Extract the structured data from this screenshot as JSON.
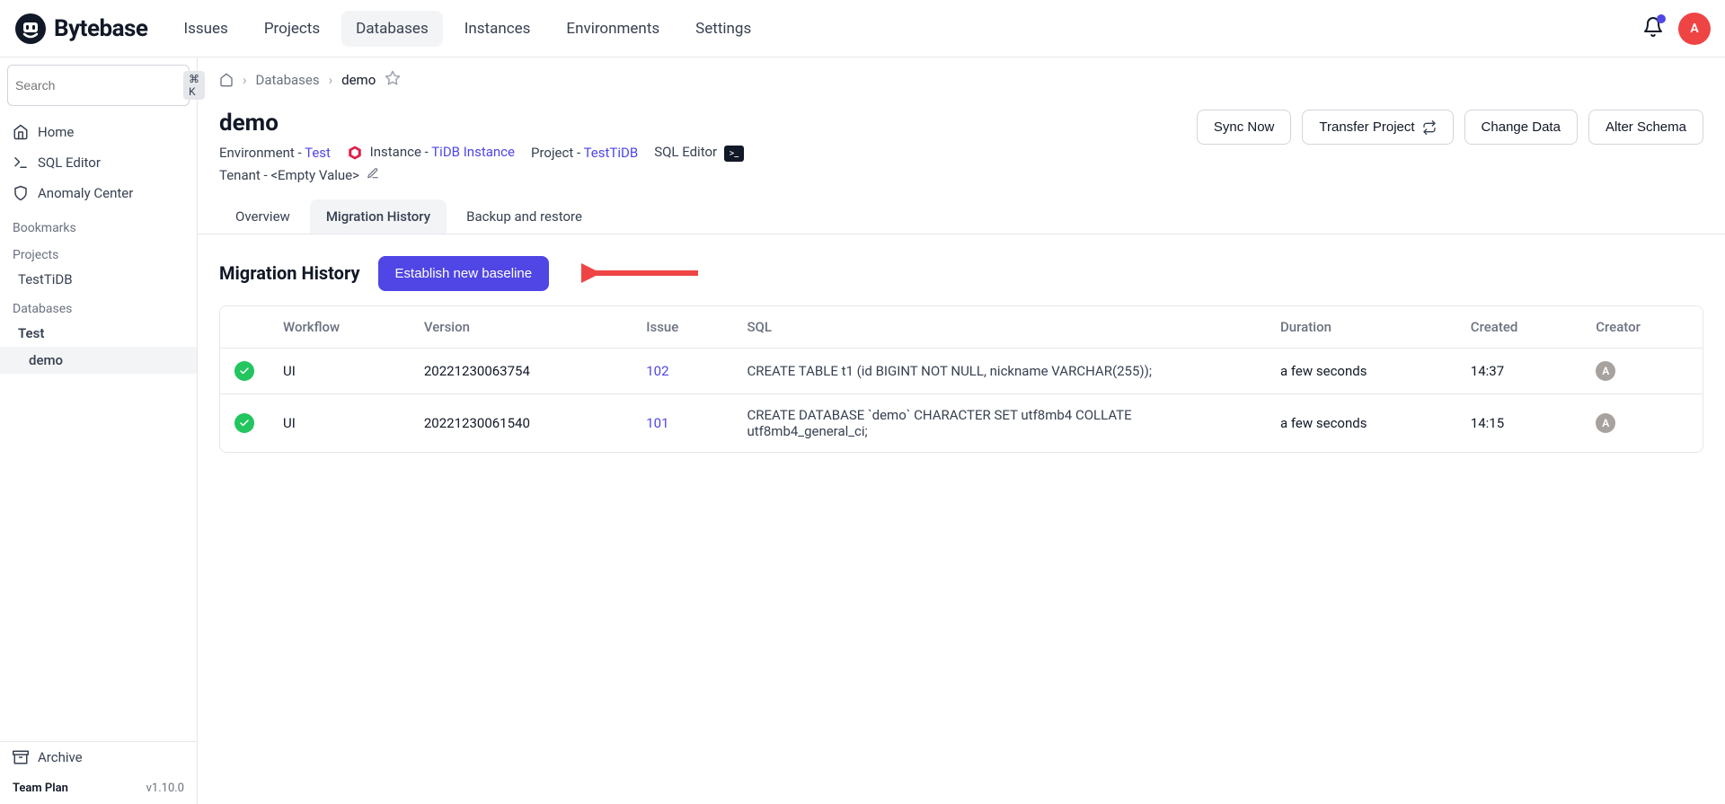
{
  "brand": "Bytebase",
  "nav": {
    "items": [
      {
        "label": "Issues"
      },
      {
        "label": "Projects"
      },
      {
        "label": "Databases",
        "active": true
      },
      {
        "label": "Instances"
      },
      {
        "label": "Environments"
      },
      {
        "label": "Settings"
      }
    ]
  },
  "avatar_letter": "A",
  "sidebar": {
    "search_placeholder": "Search",
    "search_kbd": "⌘ K",
    "links": [
      {
        "label": "Home"
      },
      {
        "label": "SQL Editor"
      },
      {
        "label": "Anomaly Center"
      }
    ],
    "sections": {
      "bookmarks": "Bookmarks",
      "projects": "Projects",
      "databases": "Databases"
    },
    "project_items": [
      {
        "label": "TestTiDB"
      }
    ],
    "database_items": [
      {
        "label": "Test",
        "children": [
          {
            "label": "demo",
            "active": true
          }
        ]
      }
    ],
    "archive": "Archive",
    "plan": "Team Plan",
    "version": "v1.10.0"
  },
  "breadcrumb": {
    "items": [
      "Databases",
      "demo"
    ]
  },
  "page": {
    "title": "demo",
    "env_label": "Environment - ",
    "env_value": "Test",
    "instance_label": "Instance - ",
    "instance_value": "TiDB Instance",
    "project_label": "Project - ",
    "project_value": "TestTiDB",
    "sql_editor": "SQL Editor",
    "tenant_label": "Tenant - ",
    "tenant_value": "<Empty Value>"
  },
  "actions": {
    "sync": "Sync Now",
    "transfer": "Transfer Project",
    "change_data": "Change Data",
    "alter_schema": "Alter Schema"
  },
  "tabs": [
    {
      "label": "Overview"
    },
    {
      "label": "Migration History",
      "active": true
    },
    {
      "label": "Backup and restore"
    }
  ],
  "section": {
    "title": "Migration History",
    "button": "Establish new baseline"
  },
  "table": {
    "headers": [
      "",
      "Workflow",
      "Version",
      "Issue",
      "SQL",
      "Duration",
      "Created",
      "Creator"
    ],
    "rows": [
      {
        "status": "done",
        "workflow": "UI",
        "version": "20221230063754",
        "issue": "102",
        "sql": "CREATE TABLE t1 (id BIGINT NOT NULL, nickname VARCHAR(255));",
        "duration": "a few seconds",
        "created": "14:37",
        "creator": "A"
      },
      {
        "status": "done",
        "workflow": "UI",
        "version": "20221230061540",
        "issue": "101",
        "sql": "CREATE DATABASE `demo` CHARACTER SET utf8mb4 COLLATE utf8mb4_general_ci;",
        "duration": "a few seconds",
        "created": "14:15",
        "creator": "A"
      }
    ]
  }
}
